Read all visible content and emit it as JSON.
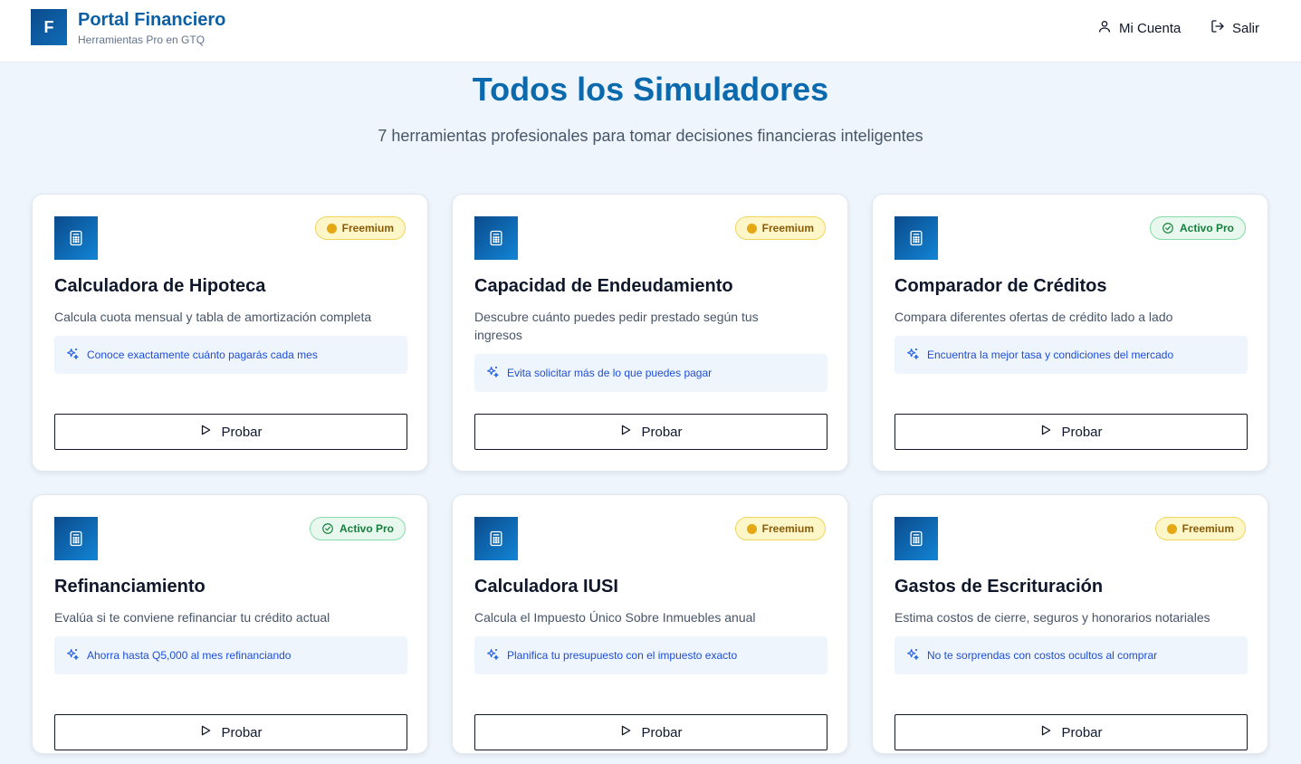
{
  "header": {
    "logo_letter": "F",
    "brand_name": "Portal Financiero",
    "brand_tagline": "Herramientas Pro en GTQ",
    "nav": [
      {
        "label": "Mi Cuenta",
        "icon": "user-icon"
      },
      {
        "label": "Salir",
        "icon": "logout-icon"
      }
    ]
  },
  "main": {
    "title": "Todos los Simuladores",
    "subtitle": "7 herramientas profesionales para tomar decisiones financieras inteligentes"
  },
  "cards": [
    {
      "title": "Calculadora de Hipoteca",
      "description": "Calcula cuota mensual y tabla de amortización completa",
      "tip": "Conoce exactamente cuánto pagarás cada mes",
      "badge": "Freemium",
      "badge_type": "freemium",
      "button": "Probar"
    },
    {
      "title": "Capacidad de Endeudamiento",
      "description": "Descubre cuánto puedes pedir prestado según tus ingresos",
      "tip": "Evita solicitar más de lo que puedes pagar",
      "badge": "Freemium",
      "badge_type": "freemium",
      "button": "Probar"
    },
    {
      "title": "Comparador de Créditos",
      "description": "Compara diferentes ofertas de crédito lado a lado",
      "tip": "Encuentra la mejor tasa y condiciones del mercado",
      "badge": "Activo Pro",
      "badge_type": "pro",
      "button": "Probar"
    },
    {
      "title": "Refinanciamiento",
      "description": "Evalúa si te conviene refinanciar tu crédito actual",
      "tip": "Ahorra hasta Q5,000 al mes refinanciando",
      "badge": "Activo Pro",
      "badge_type": "pro",
      "button": "Probar"
    },
    {
      "title": "Calculadora IUSI",
      "description": "Calcula el Impuesto Único Sobre Inmuebles anual",
      "tip": "Planifica tu presupuesto con el impuesto exacto",
      "badge": "Freemium",
      "badge_type": "freemium",
      "button": "Probar"
    },
    {
      "title": "Gastos de Escrituración",
      "description": "Estima costos de cierre, seguros y honorarios notariales",
      "tip": "No te sorprendas con costos ocultos al comprar",
      "badge": "Freemium",
      "badge_type": "freemium",
      "button": "Probar"
    }
  ],
  "colors": {
    "brand": "#0b5fa5",
    "title": "#0b6aae",
    "background": "#eef5fc",
    "freemium_badge": "#fdf6c9",
    "pro_badge": "#e8f8ee",
    "tip_background": "#eff5fd",
    "tip_text": "#1d4ed8"
  }
}
